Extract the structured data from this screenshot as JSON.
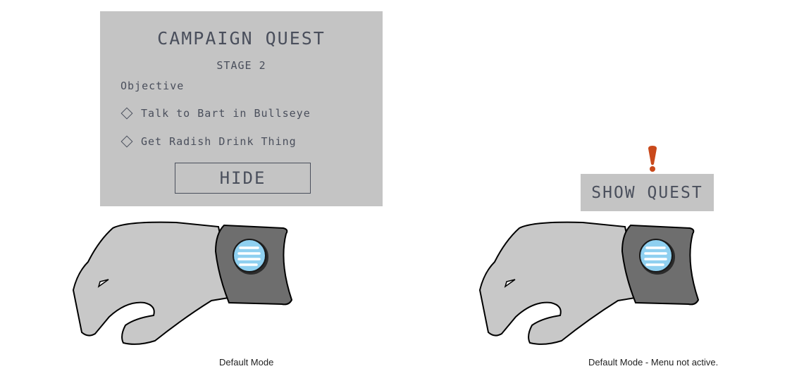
{
  "quest_panel": {
    "title": "CAMPAIGN QUEST",
    "stage": "STAGE 2",
    "objective_label": "Objective",
    "objectives": [
      "Talk to Bart in Bullseye",
      "Get Radish Drink Thing"
    ],
    "hide_label": "HIDE"
  },
  "collapsed": {
    "show_label": "SHOW QUEST",
    "alert_color": "#c9491b"
  },
  "captions": {
    "left": "Default Mode",
    "right": "Default Mode - Menu not active."
  },
  "colors": {
    "panel_bg": "#c4c4c4",
    "text": "#4a4f5c",
    "glove": "#c8c8c8",
    "cuff": "#6e6e6e",
    "button_face": "#8fd0f0"
  },
  "icons": {
    "objective_bullet": "diamond-outline-icon",
    "wrist_button": "menu-lines-icon",
    "alert": "exclamation-icon"
  }
}
